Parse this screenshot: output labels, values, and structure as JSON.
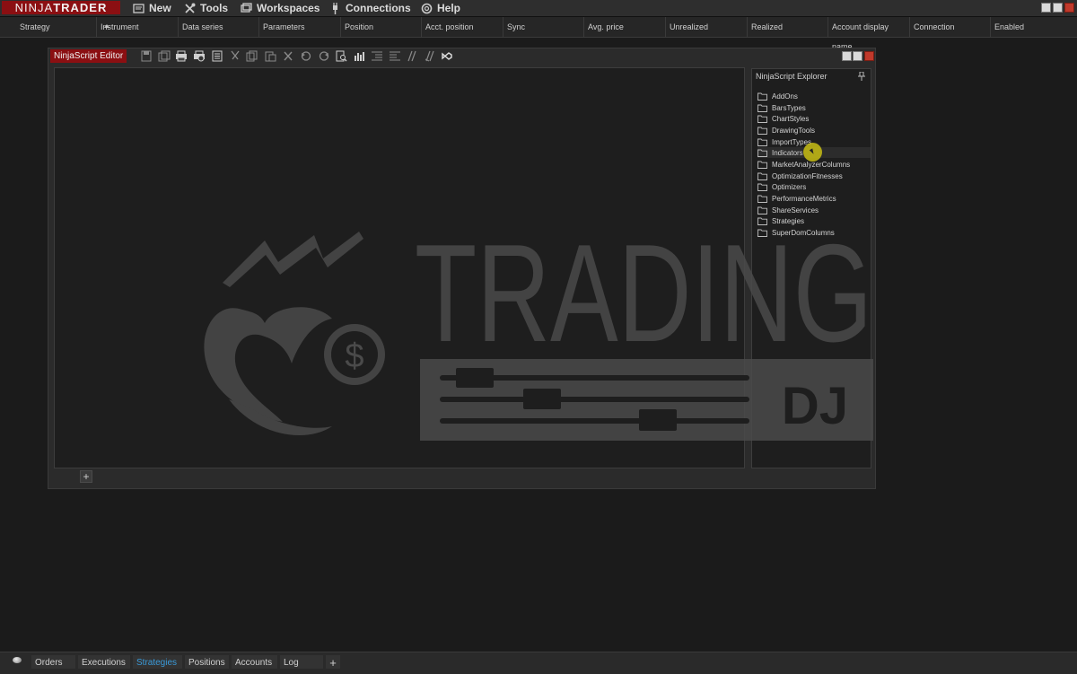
{
  "app": {
    "logo_left": "NINJA",
    "logo_right": "TRADER"
  },
  "menu": [
    {
      "label": "New",
      "icon": "new-window-icon"
    },
    {
      "label": "Tools",
      "icon": "tools-icon"
    },
    {
      "label": "Workspaces",
      "icon": "workspaces-icon"
    },
    {
      "label": "Connections",
      "icon": "connections-plug-icon"
    },
    {
      "label": "Help",
      "icon": "help-icon"
    }
  ],
  "columns": [
    "Strategy",
    "Instrument",
    "Data series",
    "Parameters",
    "Position",
    "Acct. position",
    "Sync",
    "Avg. price",
    "Unrealized",
    "Realized",
    "Account display name",
    "Connection",
    "Enabled"
  ],
  "editor": {
    "title": "NinjaScript Editor",
    "add_tab": "+"
  },
  "explorer": {
    "title": "NinjaScript Explorer",
    "items": [
      "AddOns",
      "BarsTypes",
      "ChartStyles",
      "DrawingTools",
      "ImportTypes",
      "Indicators",
      "MarketAnalyzerColumns",
      "OptimizationFitnesses",
      "Optimizers",
      "PerformanceMetrics",
      "ShareServices",
      "Strategies",
      "SuperDomColumns"
    ]
  },
  "watermark": {
    "word": "TRADING",
    "sub": "DJ",
    "currency_symbol": "$"
  },
  "bottom_tabs": [
    "Orders",
    "Executions",
    "Strategies",
    "Positions",
    "Accounts",
    "Log"
  ],
  "bottom_add": "+",
  "active_bottom_tab": "Strategies",
  "colors": {
    "brand_red": "#8b0f12",
    "active_tab_blue": "#3a9ad9",
    "cursor_yellow": "#c8be14"
  }
}
